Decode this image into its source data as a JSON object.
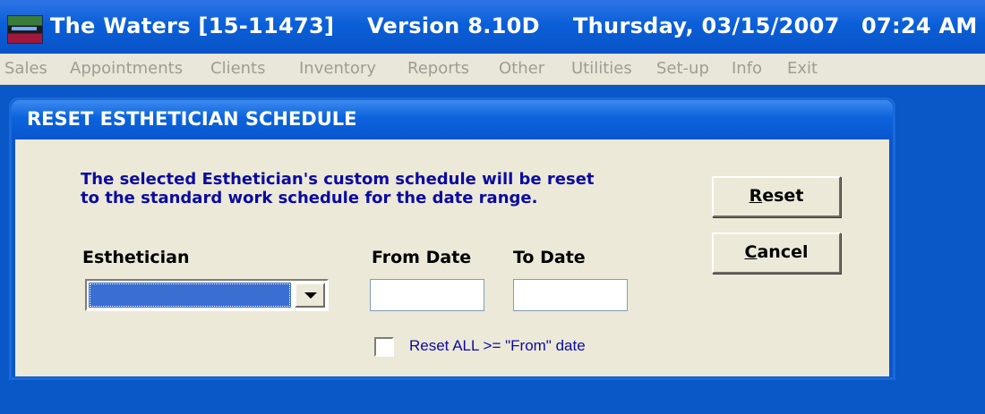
{
  "titlebar": {
    "app_name": "The Waters [15-11473]",
    "version": "Version 8.10D",
    "date": "Thursday, 03/15/2007",
    "time": "07:24 AM"
  },
  "menu": {
    "items": [
      "Sales",
      "Appointments",
      "Clients",
      "Inventory",
      "Reports",
      "Other",
      "Utilities",
      "Set-up",
      "Info",
      "Exit"
    ]
  },
  "dialog": {
    "title": "RESET ESTHETICIAN SCHEDULE",
    "instructions_line1": "The selected Esthetician's custom schedule will be reset",
    "instructions_line2": "to the standard work schedule for the date range.",
    "esthetician_label": "Esthetician",
    "esthetician_value": "",
    "from_date_label": "From Date",
    "from_date_value": "",
    "to_date_label": "To Date",
    "to_date_value": "",
    "reset_all_label": "Reset ALL >= \"From\" date",
    "reset_all_checked": false,
    "reset_button": {
      "accel": "R",
      "rest": "eset"
    },
    "cancel_button": {
      "accel": "C",
      "rest": "ancel"
    }
  },
  "colors": {
    "desktop": "#0a57c8",
    "dialog_body": "#ece9d8",
    "instruction_text": "#0b0ba0",
    "menu_text_disabled": "#9f9d92"
  }
}
